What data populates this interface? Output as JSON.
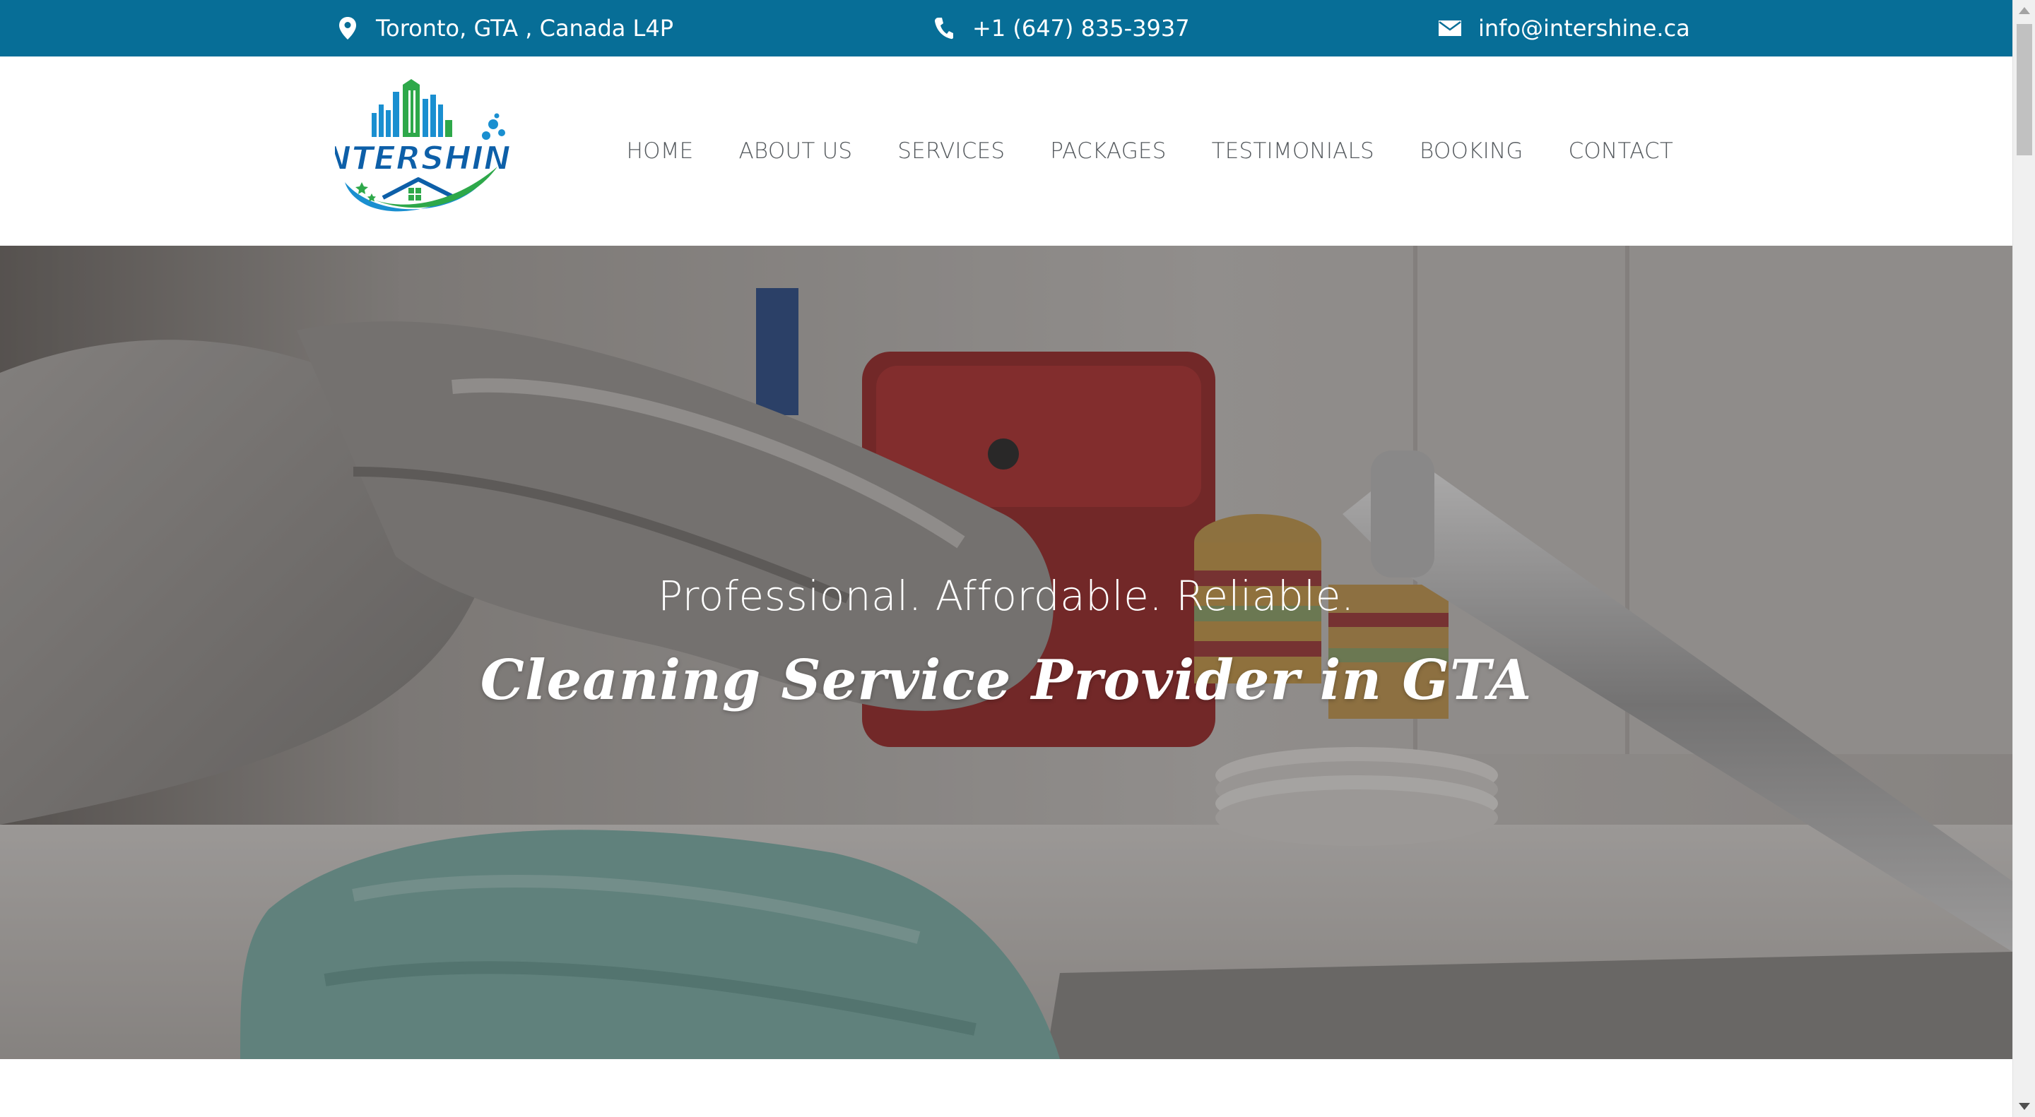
{
  "topbar": {
    "location": "Toronto, GTA , Canada L4P",
    "phone": "+1 (647) 835-3937",
    "email": "info@intershine.ca",
    "background_color": "#076e97",
    "icons": {
      "location": "map-pin-icon",
      "phone": "phone-icon",
      "email": "envelope-icon"
    }
  },
  "header": {
    "logo_text": "INTERSHINE",
    "nav": {
      "items": [
        {
          "label": "HOME"
        },
        {
          "label": "ABOUT US"
        },
        {
          "label": "SERVICES"
        },
        {
          "label": "PACKAGES"
        },
        {
          "label": "TESTIMONIALS"
        },
        {
          "label": "BOOKING"
        },
        {
          "label": "CONTACT"
        }
      ]
    }
  },
  "hero": {
    "tagline": "Professional. Affordable. Reliable.",
    "heading": "Cleaning Service Provider in GTA"
  },
  "colors": {
    "brand_blue": "#076e97",
    "logo_blue": "#1a8fd0",
    "logo_green": "#2ea84a",
    "nav_text": "#555a5e"
  }
}
